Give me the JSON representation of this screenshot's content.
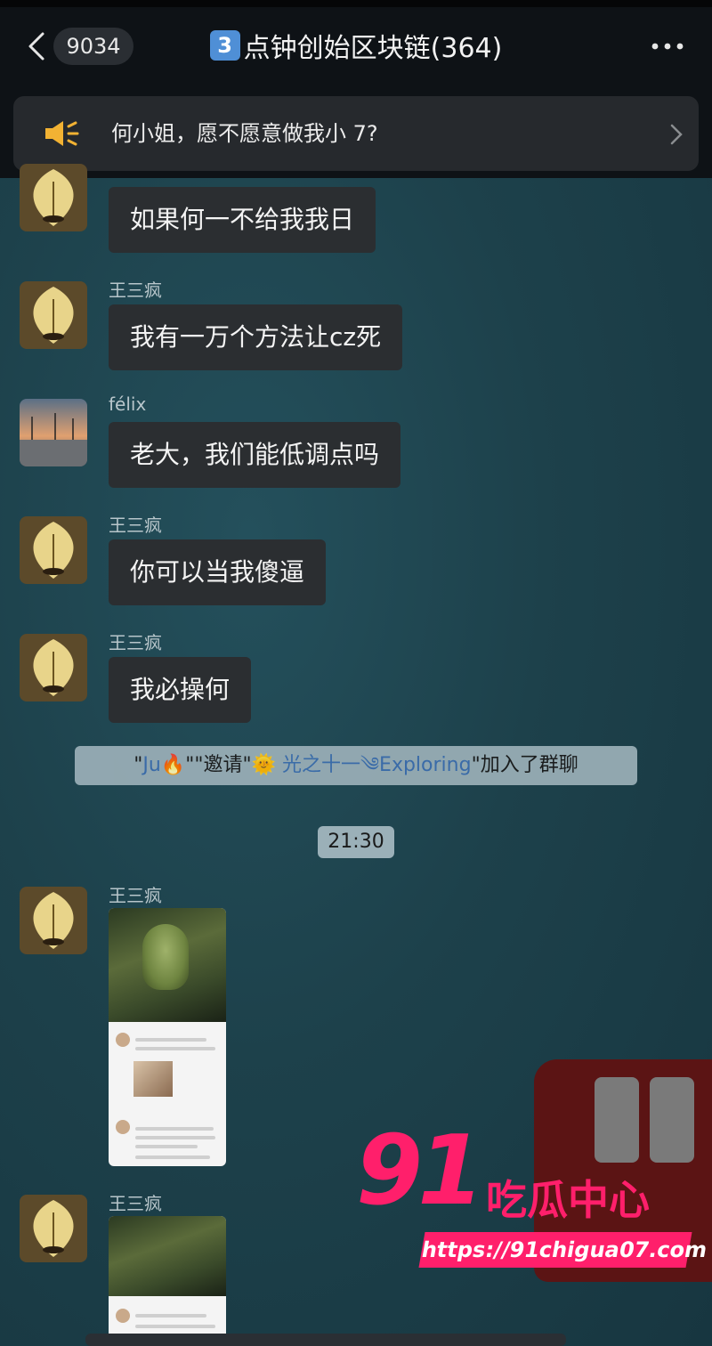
{
  "header": {
    "unread_count": "9034",
    "title_keycap": "3",
    "title": "点钟创始区块链(364)",
    "colors": {
      "bar": "#0e1216",
      "keycap": "#4f8fd6"
    }
  },
  "pinned_notice": {
    "icon": "megaphone-icon",
    "text": "何小姐，愿不愿意做我小 7?"
  },
  "messages": [
    {
      "sender": "",
      "text": "如果何一不给我我日",
      "avatar": "leaf-candle-avatar"
    },
    {
      "sender": "王三疯",
      "text": "我有一万个方法让cz死",
      "avatar": "leaf-candle-avatar"
    },
    {
      "sender": "félix",
      "text": "老大，我们能低调点吗",
      "avatar": "sunset-beach-avatar"
    },
    {
      "sender": "王三疯",
      "text": "你可以当我傻逼",
      "avatar": "leaf-candle-avatar"
    },
    {
      "sender": "王三疯",
      "text": "我必操何",
      "avatar": "leaf-candle-avatar"
    }
  ],
  "system_notice": {
    "q1": "\"",
    "inviter": "Ju🔥",
    "q2": "\"",
    "action": "\"邀请\"",
    "invitee_emoji": "🌞",
    "invitee": "光之十一",
    "invitee_symbol": "༄",
    "invitee_suffix": "Exploring",
    "tail": "\"加入了群聊"
  },
  "timestamp": "21:30",
  "image_messages": [
    {
      "sender": "王三疯",
      "content": "screenshot-image"
    },
    {
      "sender": "王三疯",
      "content": "screenshot-image"
    }
  ],
  "watermark": {
    "number": "91",
    "title": "吃瓜中心",
    "url": "https://91chigua07.com",
    "color": "#ff1f6b"
  }
}
